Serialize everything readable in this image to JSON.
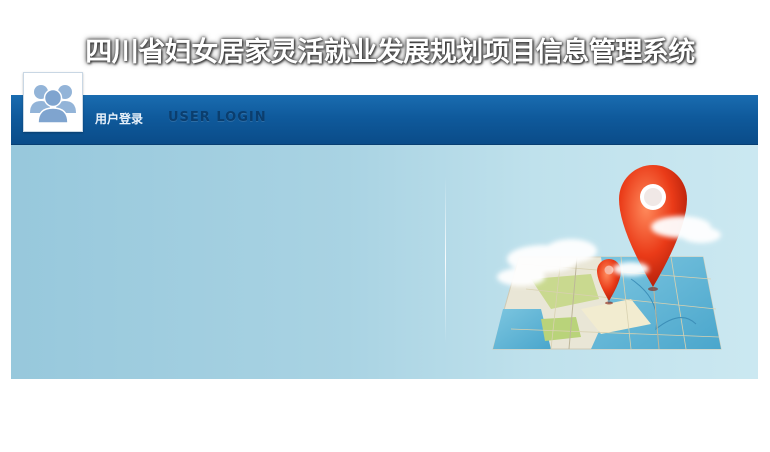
{
  "header": {
    "system_title": "四川省妇女居家灵活就业发展规划项目信息管理系统"
  },
  "login_panel": {
    "label_cn": "用户登录",
    "label_en": "USER LOGIN"
  },
  "icons": {
    "avatar": "users-group-icon",
    "illustration": "map-location-pin-icon"
  },
  "colors": {
    "header_bar": "#0f5a9c",
    "panel_bg": "#a9d3e3",
    "pin": "#e8381a"
  }
}
